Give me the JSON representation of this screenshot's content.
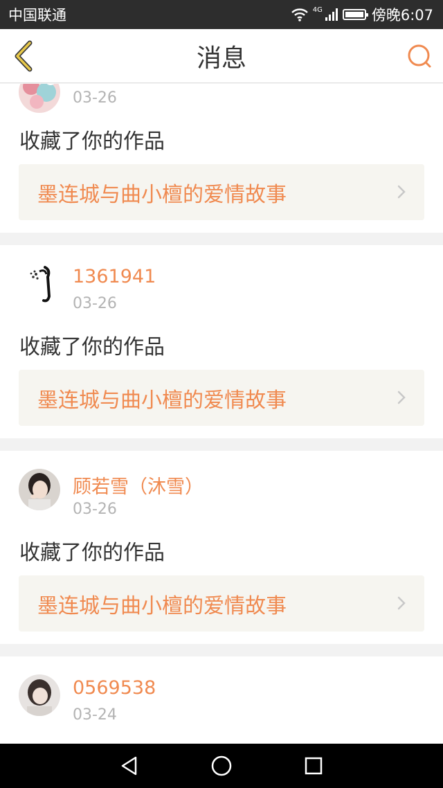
{
  "status_bar": {
    "carrier": "中国联通",
    "network_tag": "4G",
    "time": "傍晚6:07",
    "icons": [
      "wifi-icon",
      "signal-icon",
      "battery-icon"
    ]
  },
  "header": {
    "title": "消息",
    "back_icon": "chevron-left-icon",
    "search_icon": "search-icon"
  },
  "colors": {
    "accent": "#f08a50",
    "back_icon": "#e8c94a",
    "status_bar": "#2d2d2d",
    "link_background": "#f6f5f0"
  },
  "messages": [
    {
      "user": "",
      "date": "03-26",
      "action": "收藏了你的作品",
      "work_title": "墨连城与曲小檀的爱情故事"
    },
    {
      "user": "1361941",
      "date": "03-26",
      "action": "收藏了你的作品",
      "work_title": "墨连城与曲小檀的爱情故事"
    },
    {
      "user": "顾若雪（沐雪）",
      "date": "03-26",
      "action": "收藏了你的作品",
      "work_title": "墨连城与曲小檀的爱情故事"
    },
    {
      "user": "0569538",
      "date": "03-24"
    }
  ],
  "system_nav": {
    "icons": [
      "back-triangle-icon",
      "home-circle-icon",
      "recents-square-icon"
    ]
  }
}
